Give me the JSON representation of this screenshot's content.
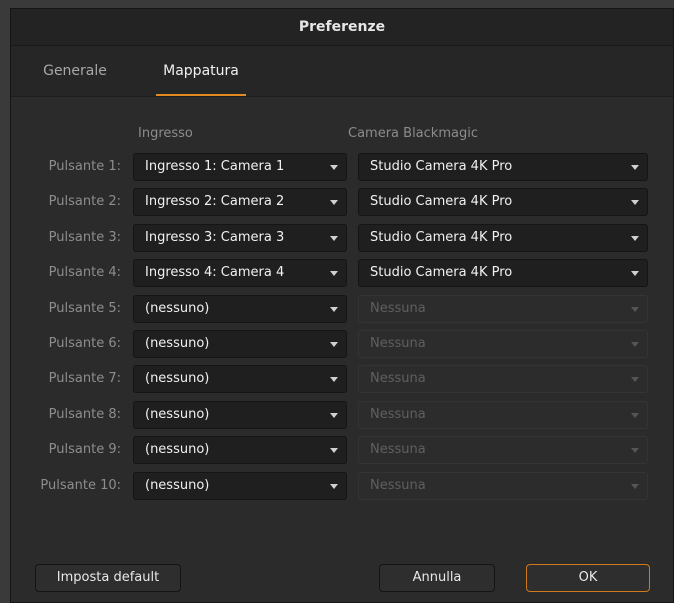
{
  "window": {
    "title": "Preferenze"
  },
  "tabs": [
    {
      "label": "Generale",
      "active": false
    },
    {
      "label": "Mappatura",
      "active": true
    }
  ],
  "columns": {
    "input": "Ingresso",
    "camera": "Camera Blackmagic"
  },
  "rows": [
    {
      "label": "Pulsante 1:",
      "input": "Ingresso 1: Camera 1",
      "camera": "Studio Camera 4K Pro",
      "camera_enabled": true
    },
    {
      "label": "Pulsante 2:",
      "input": "Ingresso 2: Camera 2",
      "camera": "Studio Camera 4K Pro",
      "camera_enabled": true
    },
    {
      "label": "Pulsante 3:",
      "input": "Ingresso 3: Camera 3",
      "camera": "Studio Camera 4K Pro",
      "camera_enabled": true
    },
    {
      "label": "Pulsante 4:",
      "input": "Ingresso 4: Camera 4",
      "camera": "Studio Camera 4K Pro",
      "camera_enabled": true
    },
    {
      "label": "Pulsante 5:",
      "input": "(nessuno)",
      "camera": "Nessuna",
      "camera_enabled": false
    },
    {
      "label": "Pulsante 6:",
      "input": "(nessuno)",
      "camera": "Nessuna",
      "camera_enabled": false
    },
    {
      "label": "Pulsante 7:",
      "input": "(nessuno)",
      "camera": "Nessuna",
      "camera_enabled": false
    },
    {
      "label": "Pulsante 8:",
      "input": "(nessuno)",
      "camera": "Nessuna",
      "camera_enabled": false
    },
    {
      "label": "Pulsante 9:",
      "input": "(nessuno)",
      "camera": "Nessuna",
      "camera_enabled": false
    },
    {
      "label": "Pulsante 10:",
      "input": "(nessuno)",
      "camera": "Nessuna",
      "camera_enabled": false
    }
  ],
  "buttons": {
    "default_label": "Imposta default",
    "cancel_label": "Annulla",
    "ok_label": "OK"
  },
  "colors": {
    "accent": "#e08a1f",
    "background": "#2b2b2b"
  }
}
